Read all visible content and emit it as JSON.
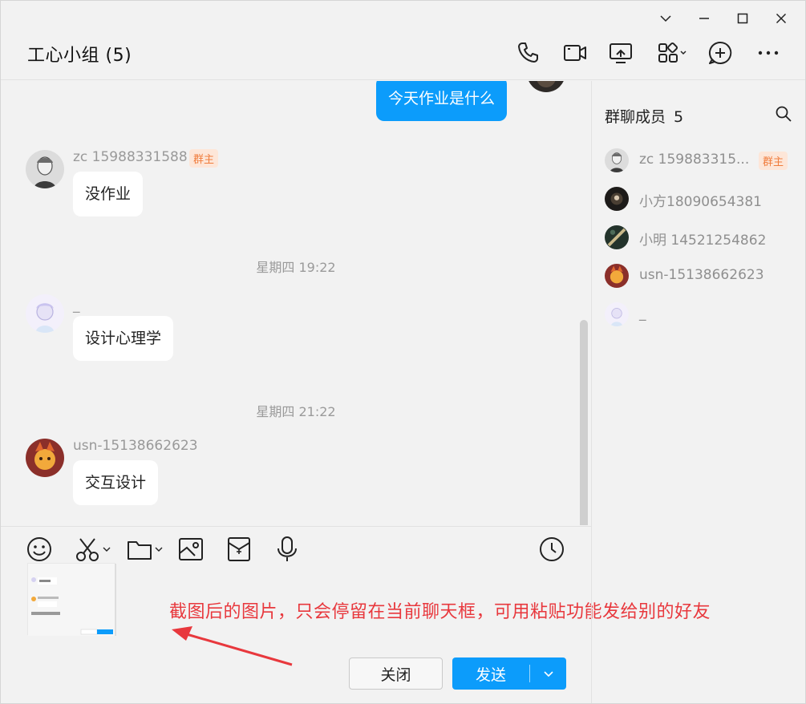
{
  "window": {
    "controls": [
      "chevron-down-icon",
      "minimize-icon",
      "maximize-icon",
      "close-icon"
    ]
  },
  "header": {
    "title": "工心小组 (5)",
    "tools": [
      "phone-icon",
      "video-call-icon",
      "screen-share-icon",
      "apps-icon",
      "add-chat-icon",
      "more-icon"
    ]
  },
  "messages": [
    {
      "type": "self",
      "text": "今天作业是什么"
    },
    {
      "type": "other",
      "sender": "zc 15988331588",
      "badge": "群主",
      "text": "没作业"
    },
    {
      "type": "time",
      "text": "星期四 19:22"
    },
    {
      "type": "other",
      "sender": "_",
      "text": "设计心理学"
    },
    {
      "type": "time",
      "text": "星期四 21:22"
    },
    {
      "type": "other",
      "sender": "usn-15138662623",
      "text": "交互设计"
    }
  ],
  "composer": {
    "tools": [
      "emoji-icon",
      "scissors-icon",
      "folder-icon",
      "image-icon",
      "red-packet-icon",
      "microphone-icon",
      "history-icon"
    ],
    "annotation": "截图后的图片，只会停留在当前聊天框，可用粘贴功能发给别的好友",
    "close_label": "关闭",
    "send_label": "发送"
  },
  "members": {
    "title": "群聊成员",
    "count": "5",
    "list": [
      {
        "name": "zc 159883315...",
        "badge": "群主"
      },
      {
        "name": "小方18090654381"
      },
      {
        "name": "小明 14521254862"
      },
      {
        "name": "usn-15138662623"
      },
      {
        "name": "_"
      }
    ]
  },
  "colors": {
    "accent": "#0c9cfb",
    "owner_badge_text": "#f07c3c",
    "owner_badge_bg": "#fde6d8",
    "annotation": "#e8383d"
  }
}
